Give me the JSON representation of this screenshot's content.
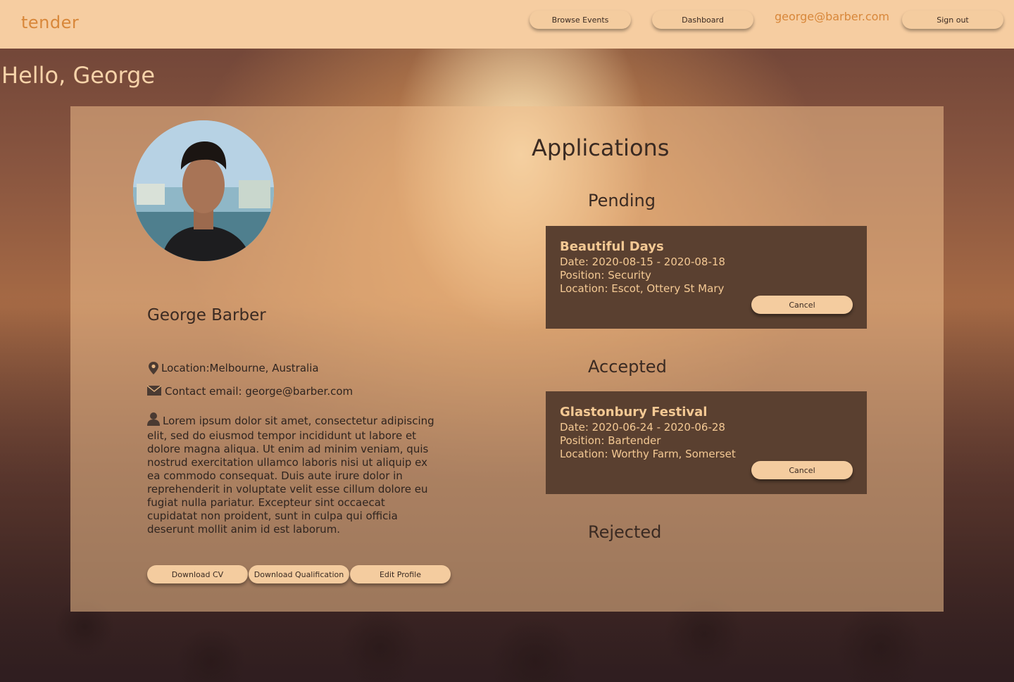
{
  "colors": {
    "header_bg": "#f6cda1",
    "accent": "#d8873a",
    "card_dark": "#5a4030",
    "button": "#f4cc9f"
  },
  "header": {
    "brand": "tender",
    "nav": {
      "browse_events": "Browse Events",
      "dashboard": "Dashboard"
    },
    "user_email": "george@barber.com",
    "sign_out": "Sign out"
  },
  "greeting": "Hello, George",
  "profile": {
    "name": "George Barber",
    "location": "Location:Melbourne, Australia",
    "contact": "Contact email: george@barber.com",
    "bio": "Lorem ipsum dolor sit amet, consectetur adipiscing elit, sed do eiusmod tempor incididunt ut labore et dolore magna aliqua. Ut enim ad minim veniam, quis nostrud exercitation ullamco laboris nisi ut aliquip ex ea commodo consequat. Duis aute irure dolor in reprehenderit in voluptate velit esse cillum dolore eu fugiat nulla pariatur. Excepteur sint occaecat cupidatat non proident, sunt in culpa qui officia deserunt mollit anim id est laborum.",
    "buttons": {
      "download_cv": "Download CV",
      "download_qualification": "Download Qualification",
      "edit_profile": "Edit Profile"
    },
    "icons": {
      "location": "map-pin-icon",
      "email": "envelope-icon",
      "bio": "user-icon"
    }
  },
  "applications": {
    "title": "Applications",
    "pending": {
      "title": "Pending",
      "items": [
        {
          "name": "Beautiful Days",
          "date": "Date: 2020-08-15 - 2020-08-18",
          "position": "Position: Security",
          "location": "Location: Escot, Ottery St Mary",
          "cancel": "Cancel"
        }
      ]
    },
    "accepted": {
      "title": "Accepted",
      "items": [
        {
          "name": "Glastonbury Festival",
          "date": "Date: 2020-06-24 - 2020-06-28",
          "position": "Position: Bartender",
          "location": "Location: Worthy Farm, Somerset",
          "cancel": "Cancel"
        }
      ]
    },
    "rejected": {
      "title": "Rejected",
      "items": []
    }
  }
}
